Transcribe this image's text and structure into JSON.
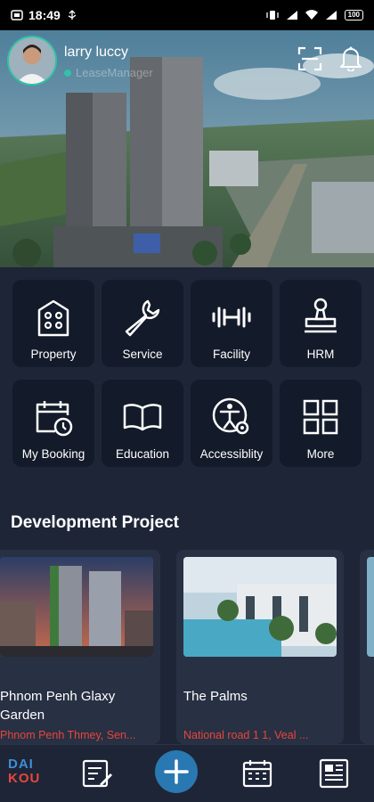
{
  "status_bar": {
    "time": "18:49",
    "battery": "100"
  },
  "user": {
    "name": "larry luccy",
    "role": "LeaseManager"
  },
  "menu": [
    {
      "label": "Property",
      "icon": "building-icon"
    },
    {
      "label": "Service",
      "icon": "wrench-icon"
    },
    {
      "label": "Facility",
      "icon": "dumbbell-icon"
    },
    {
      "label": "HRM",
      "icon": "stamp-icon"
    },
    {
      "label": "My Booking",
      "icon": "calendar-clock-icon"
    },
    {
      "label": "Education",
      "icon": "book-icon"
    },
    {
      "label": "Accessiblity",
      "icon": "accessibility-icon"
    },
    {
      "label": "More",
      "icon": "grid-icon"
    }
  ],
  "section": {
    "title": "Development Project"
  },
  "projects": [
    {
      "name": "Phnom Penh Glaxy Garden",
      "location": "Phnom Penh Thmey, Sen..."
    },
    {
      "name": "The Palms",
      "location": "National road 1 1, Veal ..."
    }
  ],
  "bottom_nav": {
    "logo_line1": "DAI",
    "logo_line2": "KOU"
  },
  "colors": {
    "background": "#1e2537",
    "tile": "#131a29",
    "card": "#283043",
    "accent": "#2ec4a6",
    "location_text": "#e8463c",
    "fab": "#2a78b2"
  }
}
